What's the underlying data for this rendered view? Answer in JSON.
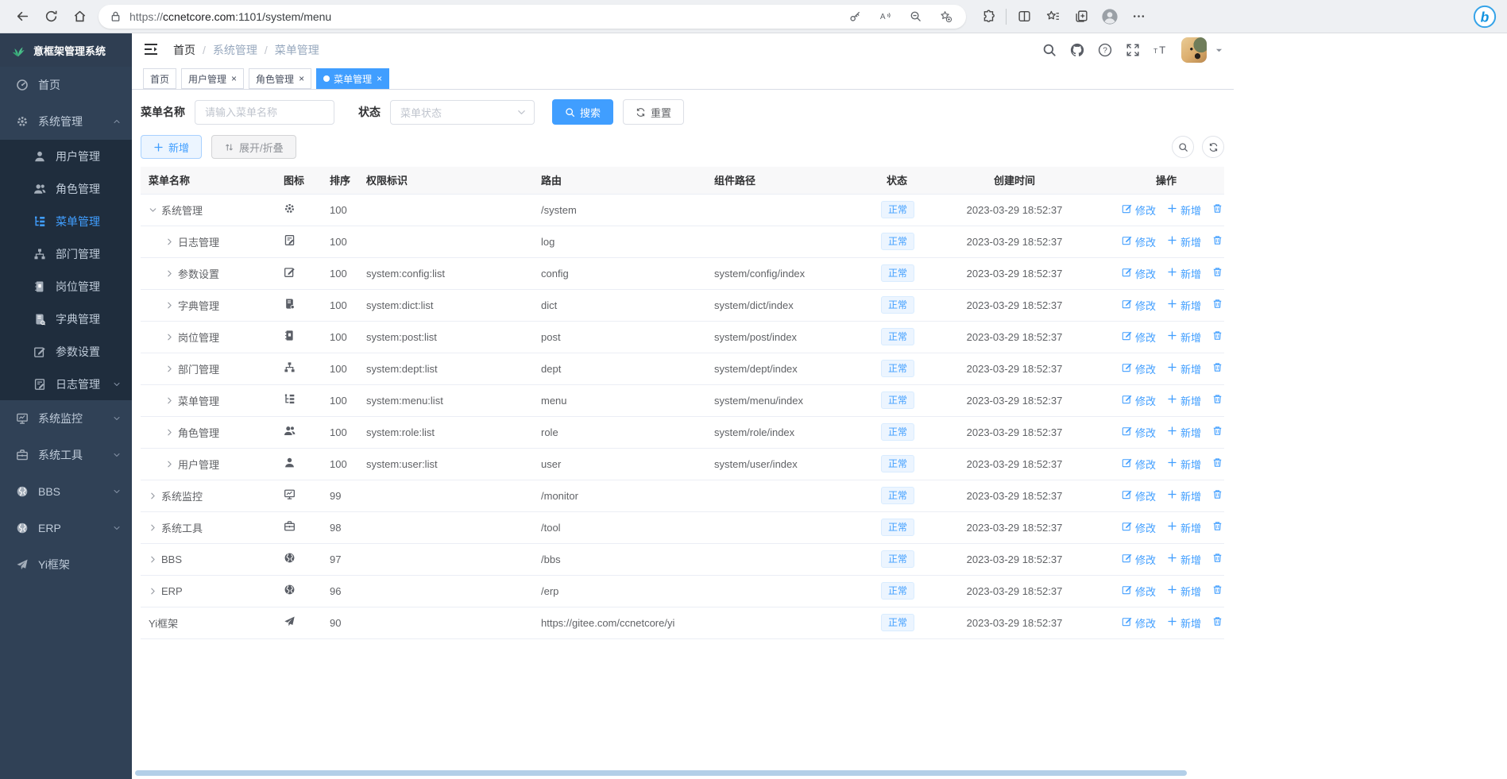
{
  "browser": {
    "url_scheme": "https://",
    "url_domain": "ccnetcore.com",
    "url_rest": ":1101/system/menu"
  },
  "colors": {
    "accent": "#409eff",
    "sidebar_bg": "#304156",
    "sidebar_sub_bg": "#1f2d3d",
    "status_badge_bg": "#ecf5ff"
  },
  "app": {
    "logo_title": "意框架管理系统",
    "breadcrumb": [
      "首页",
      "系统管理",
      "菜单管理"
    ],
    "tabs": [
      {
        "label": "首页",
        "closable": false,
        "active": false
      },
      {
        "label": "用户管理",
        "closable": true,
        "active": false
      },
      {
        "label": "角色管理",
        "closable": true,
        "active": false
      },
      {
        "label": "菜单管理",
        "closable": true,
        "active": true
      }
    ]
  },
  "sidebar": {
    "items": [
      {
        "label": "首页",
        "icon": "dashboard",
        "level": 0,
        "caret": "none",
        "active": false
      },
      {
        "label": "系统管理",
        "icon": "gear",
        "level": 0,
        "caret": "up",
        "active": false
      },
      {
        "label": "用户管理",
        "icon": "user",
        "level": 1,
        "caret": "none",
        "active": false
      },
      {
        "label": "角色管理",
        "icon": "users",
        "level": 1,
        "caret": "none",
        "active": false
      },
      {
        "label": "菜单管理",
        "icon": "tree-list",
        "level": 1,
        "caret": "none",
        "active": true
      },
      {
        "label": "部门管理",
        "icon": "org-tree",
        "level": 1,
        "caret": "none",
        "active": false
      },
      {
        "label": "岗位管理",
        "icon": "id-badge",
        "level": 1,
        "caret": "none",
        "active": false
      },
      {
        "label": "字典管理",
        "icon": "book",
        "level": 1,
        "caret": "none",
        "active": false
      },
      {
        "label": "参数设置",
        "icon": "edit-square",
        "level": 1,
        "caret": "none",
        "active": false
      },
      {
        "label": "日志管理",
        "icon": "doc-pen",
        "level": 1,
        "caret": "down",
        "active": false
      },
      {
        "label": "系统监控",
        "icon": "monitor",
        "level": 0,
        "caret": "down",
        "active": false
      },
      {
        "label": "系统工具",
        "icon": "toolbox",
        "level": 0,
        "caret": "down",
        "active": false
      },
      {
        "label": "BBS",
        "icon": "globe",
        "level": 0,
        "caret": "down",
        "active": false
      },
      {
        "label": "ERP",
        "icon": "globe",
        "level": 0,
        "caret": "down",
        "active": false
      },
      {
        "label": "Yi框架",
        "icon": "paper-plane",
        "level": 0,
        "caret": "none",
        "active": false
      }
    ]
  },
  "filters": {
    "name_label": "菜单名称",
    "name_placeholder": "请输入菜单名称",
    "name_value": "",
    "status_label": "状态",
    "status_placeholder": "菜单状态",
    "search_label": "搜索",
    "reset_label": "重置"
  },
  "toolbar": {
    "add_label": "新增",
    "expand_label": "展开/折叠"
  },
  "table": {
    "columns": [
      "菜单名称",
      "图标",
      "排序",
      "权限标识",
      "路由",
      "组件路径",
      "状态",
      "创建时间",
      "操作"
    ],
    "actions": [
      "修改",
      "新增",
      "删除"
    ],
    "rows": [
      {
        "name": "系统管理",
        "icon": "gear",
        "caret": "down",
        "level": 0,
        "sort": "100",
        "perm": "",
        "route": "/system",
        "component": "",
        "status": "正常",
        "created": "2023-03-29 18:52:37"
      },
      {
        "name": "日志管理",
        "icon": "doc-pen",
        "caret": "right",
        "level": 1,
        "sort": "100",
        "perm": "",
        "route": "log",
        "component": "",
        "status": "正常",
        "created": "2023-03-29 18:52:37"
      },
      {
        "name": "参数设置",
        "icon": "edit-square",
        "caret": "right",
        "level": 1,
        "sort": "100",
        "perm": "system:config:list",
        "route": "config",
        "component": "system/config/index",
        "status": "正常",
        "created": "2023-03-29 18:52:37"
      },
      {
        "name": "字典管理",
        "icon": "book",
        "caret": "right",
        "level": 1,
        "sort": "100",
        "perm": "system:dict:list",
        "route": "dict",
        "component": "system/dict/index",
        "status": "正常",
        "created": "2023-03-29 18:52:37"
      },
      {
        "name": "岗位管理",
        "icon": "id-badge",
        "caret": "right",
        "level": 1,
        "sort": "100",
        "perm": "system:post:list",
        "route": "post",
        "component": "system/post/index",
        "status": "正常",
        "created": "2023-03-29 18:52:37"
      },
      {
        "name": "部门管理",
        "icon": "org-tree",
        "caret": "right",
        "level": 1,
        "sort": "100",
        "perm": "system:dept:list",
        "route": "dept",
        "component": "system/dept/index",
        "status": "正常",
        "created": "2023-03-29 18:52:37"
      },
      {
        "name": "菜单管理",
        "icon": "tree-list",
        "caret": "right",
        "level": 1,
        "sort": "100",
        "perm": "system:menu:list",
        "route": "menu",
        "component": "system/menu/index",
        "status": "正常",
        "created": "2023-03-29 18:52:37"
      },
      {
        "name": "角色管理",
        "icon": "users",
        "caret": "right",
        "level": 1,
        "sort": "100",
        "perm": "system:role:list",
        "route": "role",
        "component": "system/role/index",
        "status": "正常",
        "created": "2023-03-29 18:52:37"
      },
      {
        "name": "用户管理",
        "icon": "user",
        "caret": "right",
        "level": 1,
        "sort": "100",
        "perm": "system:user:list",
        "route": "user",
        "component": "system/user/index",
        "status": "正常",
        "created": "2023-03-29 18:52:37"
      },
      {
        "name": "系统监控",
        "icon": "monitor",
        "caret": "right",
        "level": 0,
        "sort": "99",
        "perm": "",
        "route": "/monitor",
        "component": "",
        "status": "正常",
        "created": "2023-03-29 18:52:37"
      },
      {
        "name": "系统工具",
        "icon": "toolbox",
        "caret": "right",
        "level": 0,
        "sort": "98",
        "perm": "",
        "route": "/tool",
        "component": "",
        "status": "正常",
        "created": "2023-03-29 18:52:37"
      },
      {
        "name": "BBS",
        "icon": "globe",
        "caret": "right",
        "level": 0,
        "sort": "97",
        "perm": "",
        "route": "/bbs",
        "component": "",
        "status": "正常",
        "created": "2023-03-29 18:52:37"
      },
      {
        "name": "ERP",
        "icon": "globe",
        "caret": "right",
        "level": 0,
        "sort": "96",
        "perm": "",
        "route": "/erp",
        "component": "",
        "status": "正常",
        "created": "2023-03-29 18:52:37"
      },
      {
        "name": "Yi框架",
        "icon": "paper-plane",
        "caret": "none",
        "level": 0,
        "sort": "90",
        "perm": "",
        "route": "https://gitee.com/ccnetcore/yi",
        "component": "",
        "status": "正常",
        "created": "2023-03-29 18:52:37"
      }
    ]
  }
}
